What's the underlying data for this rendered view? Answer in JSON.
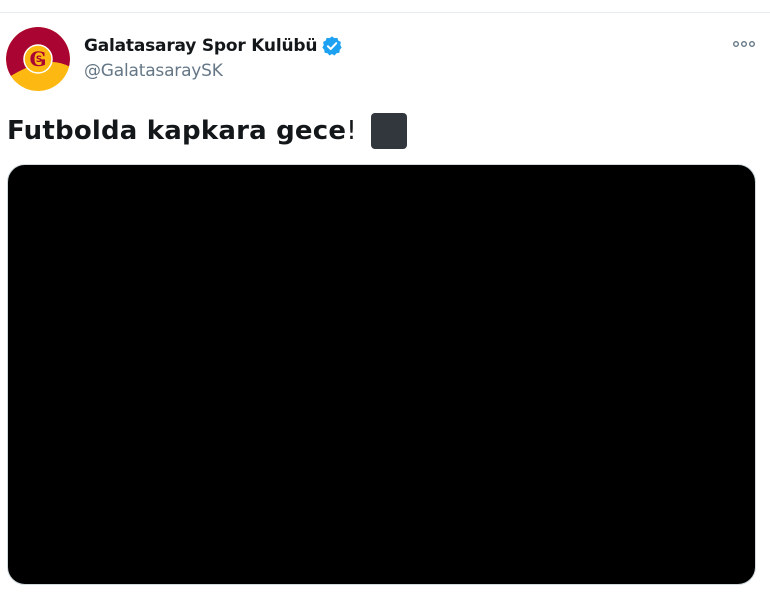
{
  "author": {
    "display_name": "Galatasaray Spor Kulübü",
    "handle": "@GalatasaraySK",
    "verified": true,
    "avatar_icon": "galatasaray-logo-icon"
  },
  "tweet": {
    "text_bold": "Futbolda kapkara gece",
    "text_suffix": "!",
    "emoji": "black-large-square",
    "media_color": "#000000"
  },
  "icons": {
    "more": "more-dots-icon",
    "verified": "verified-badge-icon"
  },
  "colors": {
    "verified_blue": "#1da1f2",
    "handle_gray": "#657786",
    "logo_red": "#a90432",
    "logo_yellow": "#fdb912"
  }
}
